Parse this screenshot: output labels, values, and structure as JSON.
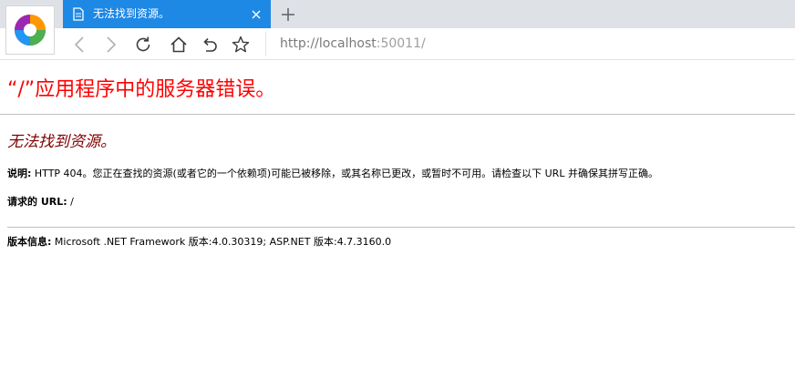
{
  "browser": {
    "tab": {
      "title": "无法找到资源。"
    },
    "address": {
      "base": "http://localhost",
      "port": ":50011/"
    },
    "icons": {
      "logo": "browser-logo-icon",
      "tab_document": "document-icon",
      "tab_close": "close-icon",
      "new_tab": "plus-icon",
      "back": "back-arrow-icon",
      "forward": "forward-arrow-icon",
      "reload": "reload-icon",
      "home": "home-icon",
      "undo": "undo-icon",
      "bookmark": "star-icon"
    },
    "colors": {
      "tab_active": "#1e88e5",
      "chrome_bg": "#dee1e6"
    }
  },
  "page": {
    "title": "“/”应用程序中的服务器错误。",
    "subtitle": "无法找到资源。",
    "description": {
      "label": "说明:",
      "text": " HTTP 404。您正在查找的资源(或者它的一个依赖项)可能已被移除，或其名称已更改，或暂时不可用。请检查以下 URL 并确保其拼写正确。"
    },
    "requested_url": {
      "label": "请求的 URL:",
      "value": " /"
    },
    "version": {
      "label": "版本信息:",
      "value": " Microsoft .NET Framework 版本:4.0.30319; ASP.NET 版本:4.7.3160.0"
    },
    "colors": {
      "title": "#ff0000",
      "subtitle": "#800000"
    }
  }
}
